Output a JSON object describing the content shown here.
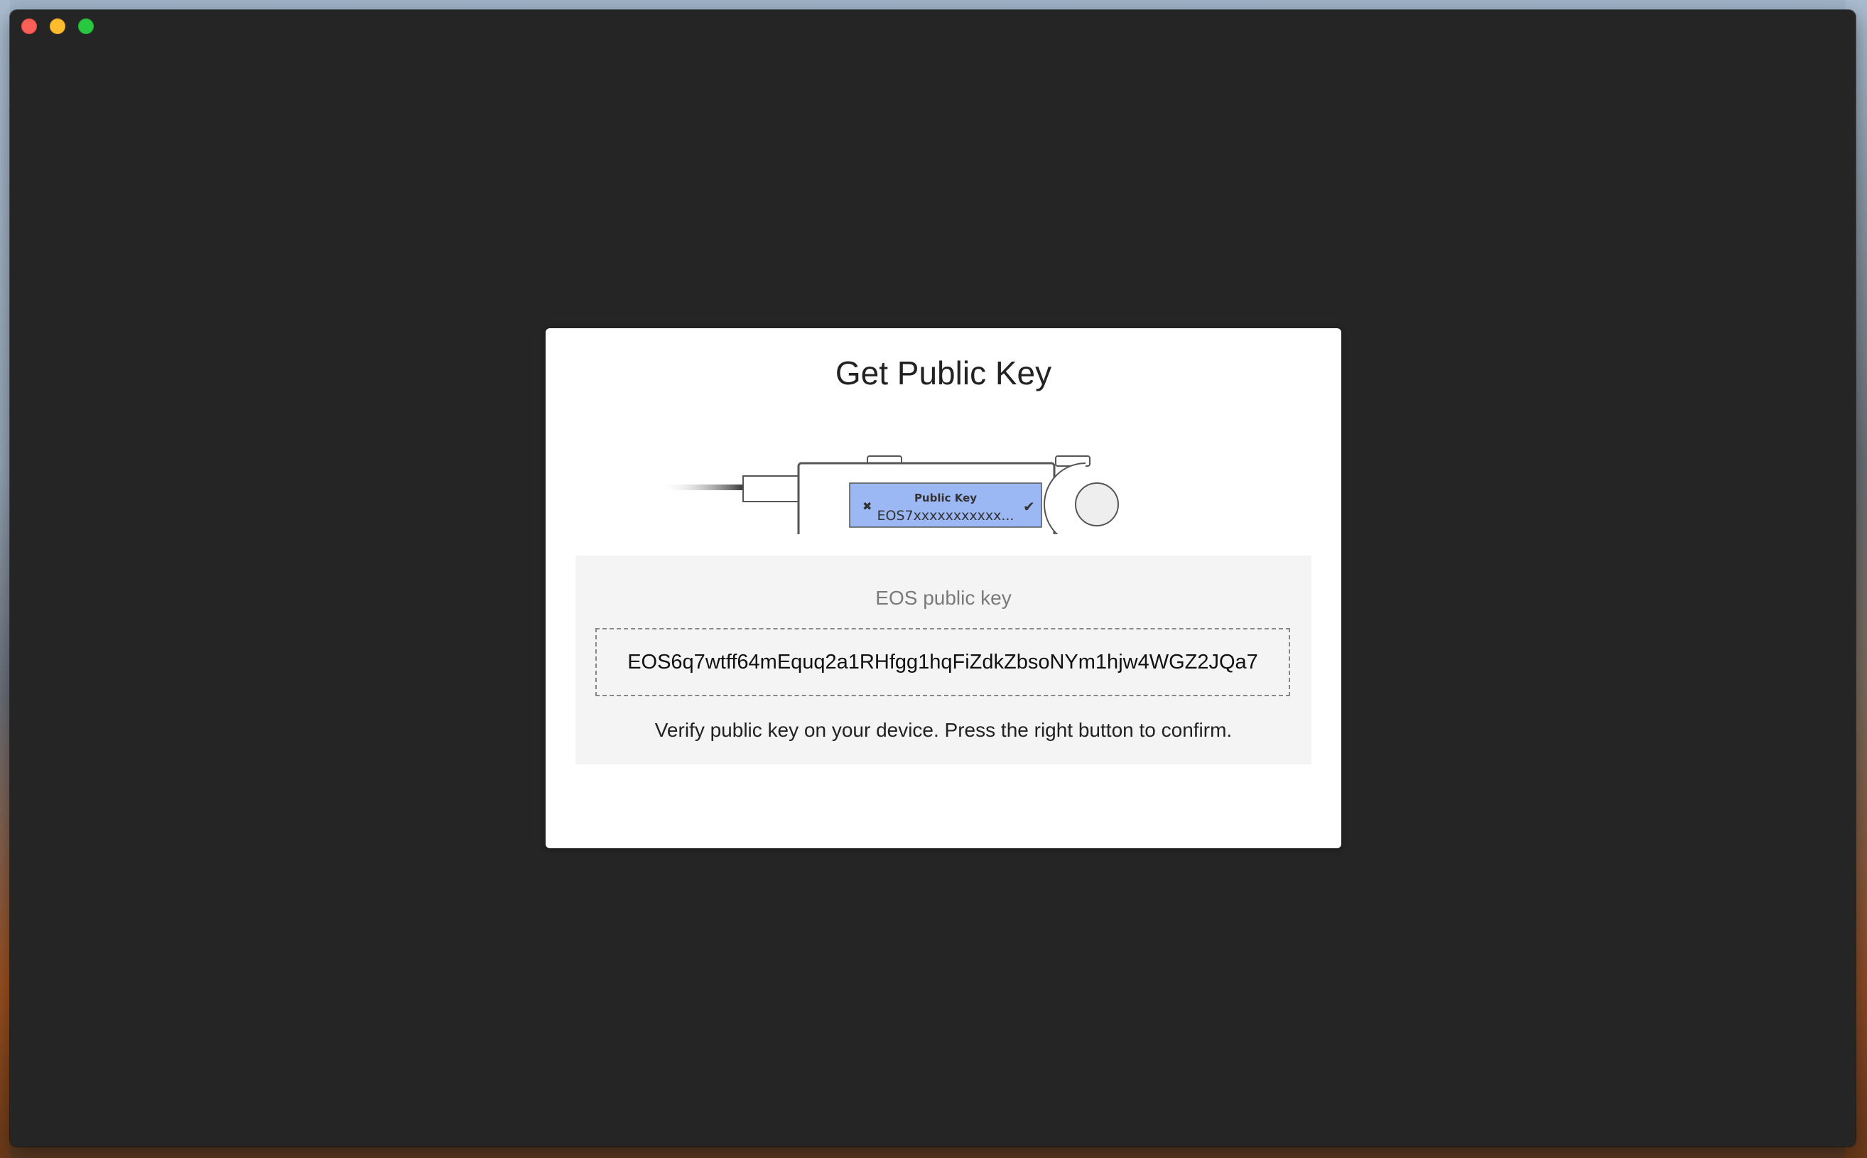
{
  "window": {
    "controls": [
      "close",
      "minimize",
      "zoom"
    ]
  },
  "modal": {
    "title": "Get Public Key",
    "device": {
      "screen_title": "Public Key",
      "screen_value": "EOS7xxxxxxxxxxx...",
      "left_icon": "cross-icon",
      "right_icon": "check-icon",
      "screen_color": "#9bb8f4"
    },
    "panel": {
      "label": "EOS public key",
      "public_key": "EOS6q7wtff64mEquq2a1RHfgg1hqFiZdkZbsoNYm1hjw4WGZ2JQa7",
      "instruction": "Verify public key on your device. Press the right button to confirm."
    }
  }
}
